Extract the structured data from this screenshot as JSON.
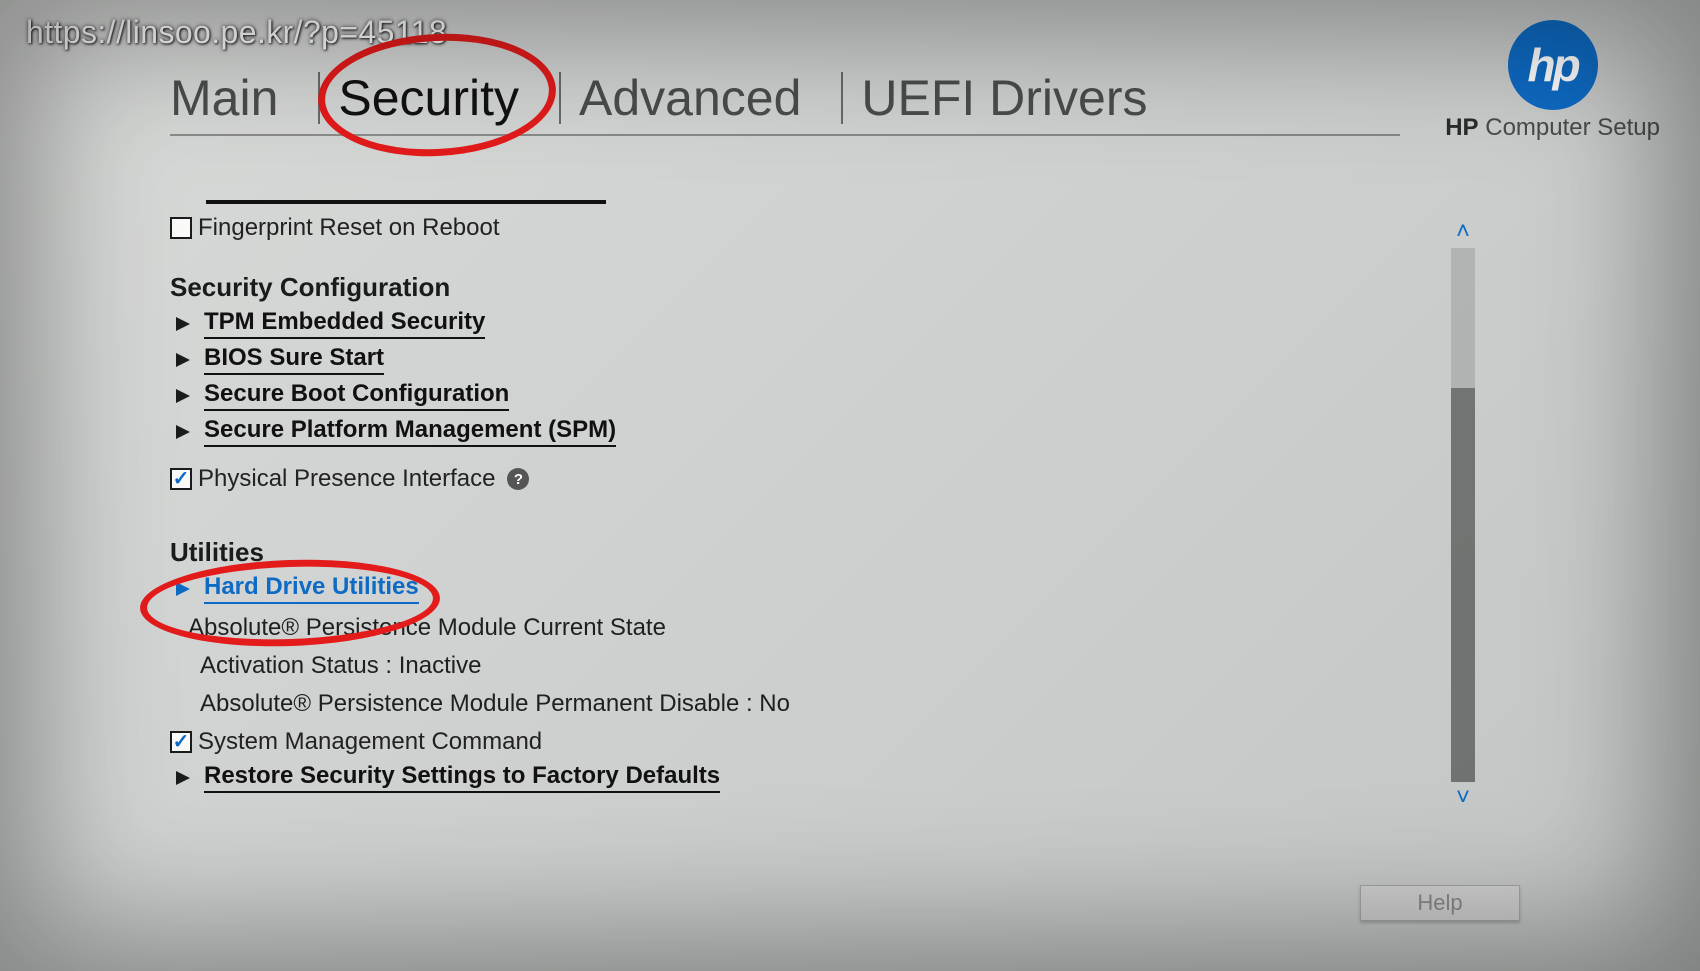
{
  "overlay_url": "https://linsoo.pe.kr/?p=45118",
  "branding": {
    "logo_text": "hp",
    "product_name_bold": "HP",
    "product_name_rest": " Computer Setup"
  },
  "tabs": [
    "Main",
    "Security",
    "Advanced",
    "UEFI Drivers"
  ],
  "active_tab_index": 1,
  "content": {
    "fingerprint_checkbox_label": "Fingerprint Reset on Reboot",
    "fingerprint_checked": false,
    "section1_title": "Security Configuration",
    "section1_links": [
      "TPM Embedded Security",
      "BIOS Sure Start",
      "Secure Boot Configuration",
      "Secure Platform Management (SPM)"
    ],
    "physical_presence_label": "Physical Presence Interface",
    "physical_presence_checked": true,
    "section2_title": "Utilities",
    "hard_drive_utilities_label": "Hard Drive Utilities",
    "absolute_state_label": "Absolute® Persistence Module Current State",
    "activation_status": "Activation Status : Inactive",
    "absolute_permanent": "Absolute® Persistence Module Permanent Disable : No",
    "sys_mgmt_label": "System Management Command",
    "sys_mgmt_checked": true,
    "restore_defaults_label": "Restore Security Settings to Factory Defaults"
  },
  "help_button": "Help"
}
